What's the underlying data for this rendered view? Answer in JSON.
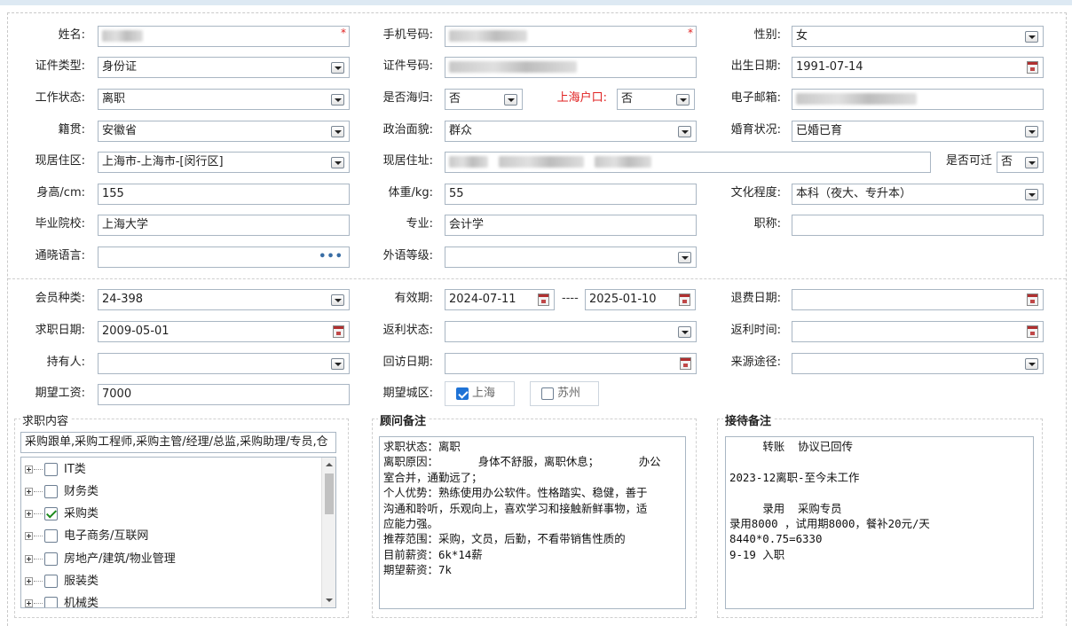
{
  "labels": {
    "name": "姓名:",
    "phone": "手机号码:",
    "gender": "性别:",
    "id_type": "证件类型:",
    "id_no": "证件号码:",
    "birth": "出生日期:",
    "work_status": "工作状态:",
    "returnee": "是否海归:",
    "sh_hukou": "上海户口:",
    "email": "电子邮箱:",
    "native": "籍贯:",
    "political": "政治面貌:",
    "marital": "婚育状况:",
    "res_area": "现居住区:",
    "res_addr": "现居住址:",
    "relocate": "是否可迁",
    "height": "身高/cm:",
    "weight": "体重/kg:",
    "education": "文化程度:",
    "school": "毕业院校:",
    "major": "专业:",
    "title": "职称:",
    "languages": "通晓语言:",
    "lang_level": "外语等级:",
    "member_type": "会员种类:",
    "valid": "有效期:",
    "refund_date": "退费日期:",
    "job_date": "求职日期:",
    "rebate_status": "返利状态:",
    "rebate_time": "返利时间:",
    "holder": "持有人:",
    "visit_date": "回访日期:",
    "source": "来源途径:",
    "salary": "期望工资:",
    "city": "期望城区:"
  },
  "values": {
    "name": "",
    "phone": "",
    "gender": "女",
    "id_type": "身份证",
    "id_no": "",
    "birth": "1991-07-14",
    "work_status": "离职",
    "returnee": "否",
    "sh_hukou": "否",
    "email": "",
    "native": "安徽省",
    "political": "群众",
    "marital": "已婚已育",
    "res_area": "上海市-上海市-[闵行区]",
    "res_addr": "",
    "relocate": "否",
    "height": "155",
    "weight": "55",
    "education": "本科（夜大、专升本）",
    "school": "上海大学",
    "major": "会计学",
    "title": "",
    "languages": "",
    "lang_level": "",
    "member_type": "24-398",
    "valid_from": "2024-07-11",
    "valid_sep": "----",
    "valid_to": "2025-01-10",
    "refund_date": "",
    "job_date": "2009-05-01",
    "rebate_status": "",
    "rebate_time": "",
    "holder": "",
    "visit_date": "",
    "source": "",
    "salary": "7000",
    "lang_more": "•••"
  },
  "cities": [
    {
      "label": "上海",
      "checked": true
    },
    {
      "label": "苏州",
      "checked": false
    }
  ],
  "job_section": {
    "title": "求职内容",
    "summary": "采购跟单,采购工程师,采购主管/经理/总监,采购助理/专员,仓",
    "tree": [
      {
        "label": "IT类",
        "checked": false
      },
      {
        "label": "财务类",
        "checked": false
      },
      {
        "label": "采购类",
        "checked": true
      },
      {
        "label": "电子商务/互联网",
        "checked": false
      },
      {
        "label": "房地产/建筑/物业管理",
        "checked": false
      },
      {
        "label": "服装类",
        "checked": false
      },
      {
        "label": "机械类",
        "checked": false
      }
    ]
  },
  "advisor_notes": {
    "title": "顾问备注",
    "text": "求职状态：离职\n离职原因：      身体不舒服，离职休息；      办公\n室合并，通勤远了；\n个人优势：熟练使用办公软件。性格踏实、稳健，善于\n沟通和聆听，乐观向上，喜欢学习和接触新鲜事物，适\n应能力强。\n推荐范围：采购，文员，后勤，不看带销售性质的\n目前薪资：6k*14薪\n期望薪资：7k"
  },
  "reception_notes": {
    "title": "接待备注",
    "text": "     转账  协议已回传\n\n2023-12离职-至今未工作\n\n     录用  采购专员\n录用8000 ，试用期8000，餐补20元/天\n8440*0.75=6330\n9-19 入职"
  },
  "colors": {
    "border": "#a9b6c3",
    "required": "#e02020",
    "topbar": "#dde9f3"
  }
}
